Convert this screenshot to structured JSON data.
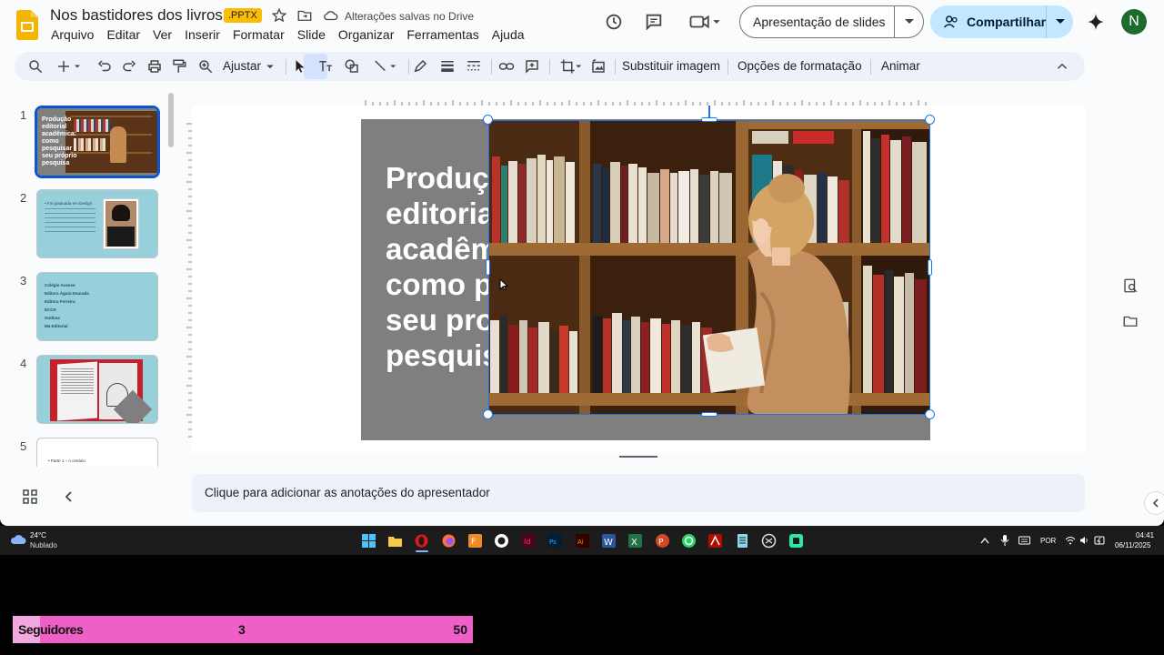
{
  "app": {
    "title": "Nos bastidores dos livros",
    "extension": ".PPTX",
    "save_status": "Alterações salvas no Drive",
    "menus": [
      "Arquivo",
      "Editar",
      "Ver",
      "Inserir",
      "Formatar",
      "Slide",
      "Organizar",
      "Ferramentas",
      "Ajuda"
    ],
    "present_label": "Apresentação de slides",
    "share_label": "Compartilhar",
    "avatar_initial": "N",
    "accent_color": "#0b57d0"
  },
  "toolbar": {
    "zoom_label": "Ajustar",
    "replace_image": "Substituir imagem",
    "format_options": "Opções de formatação",
    "animate": "Animar"
  },
  "filmstrip": {
    "slides": [
      {
        "number": "1",
        "text": "Produção editorial acadêmica: como pesquisar seu próprio pesquisa"
      },
      {
        "number": "2",
        "text": "• Foi graduada em Design"
      },
      {
        "number": "3",
        "lines": [
          "Colégio Acesso",
          "Editora Águia Dourada",
          "Editora Ferreira",
          "ECOS",
          "Outlima",
          "M4 Editorial"
        ]
      },
      {
        "number": "4"
      },
      {
        "number": "5",
        "text": "• Parte 1 – o cenário"
      }
    ]
  },
  "slide": {
    "title": "Produção\neditorial\nacadêmica:\ncomo p\nseu pro\npesquisa",
    "background": "#7f7f7f"
  },
  "notes": {
    "placeholder": "Clique para adicionar as anotações do apresentador"
  },
  "taskbar": {
    "temperature": "24°C",
    "weather": "Nublado",
    "language": "POR",
    "time": "04:41",
    "date": "06/11/2025"
  },
  "followers": {
    "label": "Seguidores",
    "current": "3",
    "goal": "50",
    "progress_fraction": 0.06
  }
}
